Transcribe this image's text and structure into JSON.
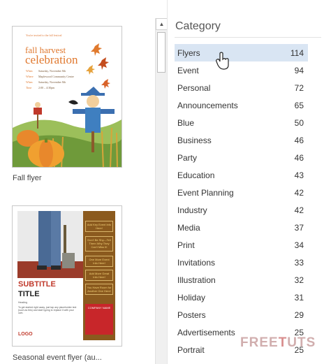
{
  "templates": [
    {
      "label": "Fall flyer",
      "preview": {
        "tagline": "You're invited to the fall festival",
        "title_line1": "fall harvest",
        "title_line2": "celebration",
        "details": [
          {
            "key": "When",
            "value": "Saturday, November 8th"
          },
          {
            "key": "Where",
            "value": "Maplewood Community Centre"
          },
          {
            "key": "When",
            "value": "Saturday, November 8th"
          },
          {
            "key": "Time",
            "value": "2:00 – 4:30pm"
          }
        ]
      }
    },
    {
      "label": "Seasonal event flyer (au...",
      "preview": {
        "subtitle": "SUBTITLE",
        "title": "TITLE",
        "heading": "Heading",
        "body": "To get started right away, just tap any placeholder text (such as this) and start typing to replace it with your own.",
        "logo": "LOGO",
        "sidebar_boxes": [
          "Add Key Event Info Here!",
          "Don't Be Shy—Tell Them Why They Can't Miss It!",
          "One More Event Info Here!",
          "Add More Great Info Here!",
          "You Have Room for Another One Here!"
        ],
        "company": "COMPANY NAME"
      }
    }
  ],
  "category": {
    "heading": "Category",
    "items": [
      {
        "name": "Flyers",
        "count": "114",
        "selected": true
      },
      {
        "name": "Event",
        "count": "94"
      },
      {
        "name": "Personal",
        "count": "72"
      },
      {
        "name": "Announcements",
        "count": "65"
      },
      {
        "name": "Blue",
        "count": "50"
      },
      {
        "name": "Business",
        "count": "46"
      },
      {
        "name": "Party",
        "count": "46"
      },
      {
        "name": "Education",
        "count": "43"
      },
      {
        "name": "Event Planning",
        "count": "42"
      },
      {
        "name": "Industry",
        "count": "42"
      },
      {
        "name": "Media",
        "count": "37"
      },
      {
        "name": "Print",
        "count": "34"
      },
      {
        "name": "Invitations",
        "count": "33"
      },
      {
        "name": "Illustration",
        "count": "32"
      },
      {
        "name": "Holiday",
        "count": "31"
      },
      {
        "name": "Posters",
        "count": "29"
      },
      {
        "name": "Advertisements",
        "count": "25"
      },
      {
        "name": "Portrait",
        "count": "25"
      }
    ]
  },
  "icons": {
    "scroll_up": "triangle-up-icon",
    "cursor": "hand-pointer-icon"
  },
  "watermark": {
    "part1": "FREE",
    "part2": "T",
    "part3": "UTS"
  },
  "colors": {
    "selected_bg": "#d9e5f3",
    "flyer_orange": "#e0782e",
    "flyer2_brown": "#8b5a1e",
    "flyer2_red": "#c8262a"
  }
}
